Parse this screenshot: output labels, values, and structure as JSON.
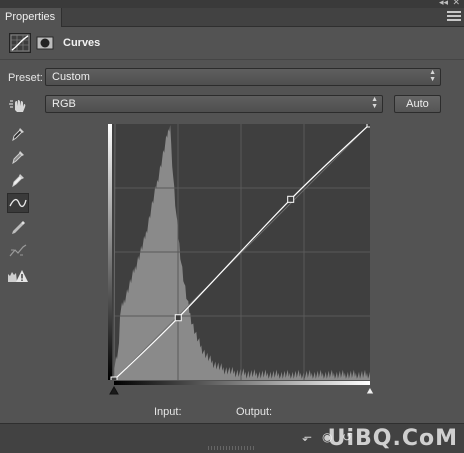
{
  "panel": {
    "tab_label": "Properties",
    "section_title": "Curves"
  },
  "preset": {
    "label": "Preset:",
    "value": "Custom"
  },
  "channel": {
    "value": "RGB",
    "auto_label": "Auto"
  },
  "tools": [
    "on-image-adjust-icon",
    "black-point-eyedropper-icon",
    "gray-point-eyedropper-icon",
    "white-point-eyedropper-icon",
    "curve-point-tool-icon",
    "pencil-draw-icon",
    "smooth-curve-icon",
    "clipping-warning-icon"
  ],
  "footer": {
    "input_label": "Input:",
    "output_label": "Output:",
    "watermark": "UiBQ.CoM"
  },
  "curve": {
    "control_points": [
      [
        0,
        0
      ],
      [
        64,
        62
      ],
      [
        176,
        180
      ],
      [
        255,
        255
      ]
    ]
  },
  "colors": {
    "panel_bg": "#535353",
    "graph_bg": "#3f3f3f",
    "histogram": "#8a8a8a",
    "curve": "#ffffff"
  }
}
